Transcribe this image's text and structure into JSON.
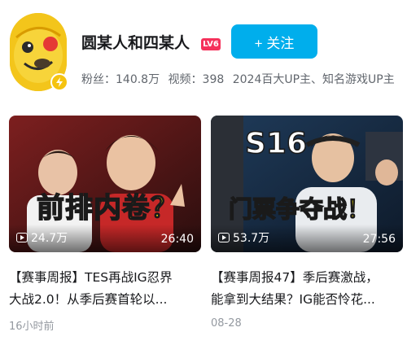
{
  "profile": {
    "name": "圆某人和四某人",
    "level": "LV6",
    "follow_label": "+ 关注",
    "stats": {
      "fans_label": "粉丝：",
      "fans_value": "140.8万",
      "videos_label": "视频：",
      "videos_value": "398",
      "honors": "2024百大UP主、知名游戏UP主"
    }
  },
  "videos": [
    {
      "thumb_text": "前排内卷？",
      "plays": "24.7万",
      "duration": "26:40",
      "title_lines": [
        "【赛事周报】TES再战IG忍界",
        "大战2.0！从季后赛首轮以..."
      ],
      "date": "16小时前"
    },
    {
      "thumb_text_top": "S16",
      "thumb_text": "门票争夺战！",
      "plays": "53.7万",
      "duration": "27:56",
      "title_lines": [
        "【赛事周报47】季后赛激战，",
        "能拿到大结果？IG能否怜花..."
      ],
      "date": "08-28"
    }
  ],
  "colors": {
    "follow": "#00aeec",
    "level": "#f5315b",
    "avatar_bg": "#f3c51b",
    "meta_text": "#61666d",
    "date_text": "#9499a0"
  }
}
